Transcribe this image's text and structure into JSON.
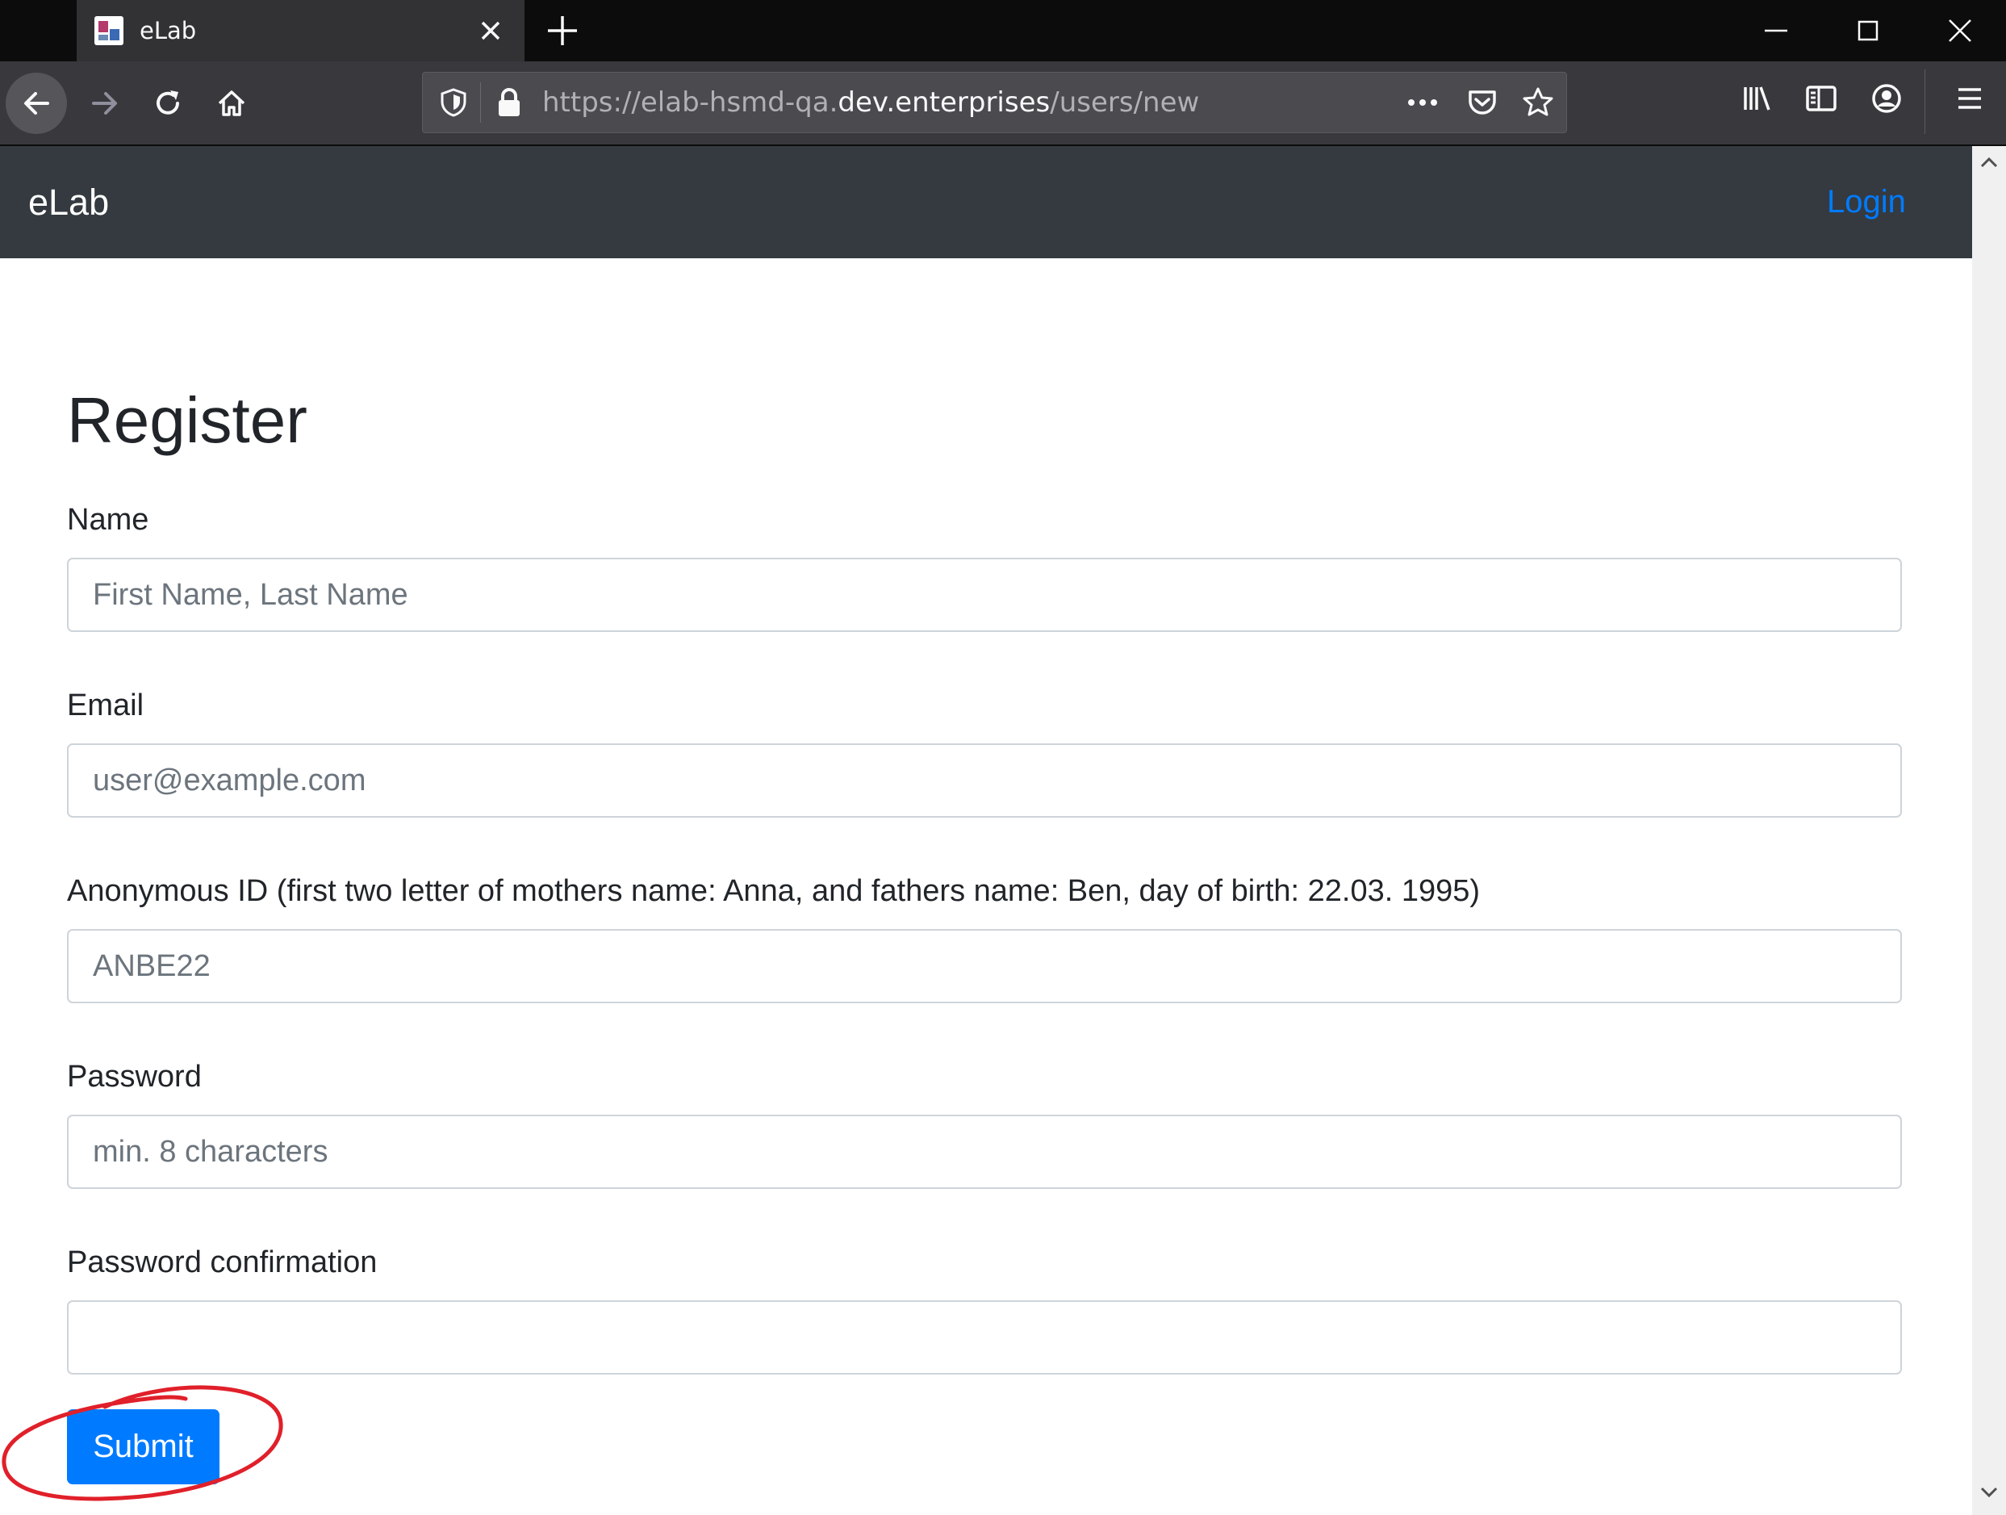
{
  "browser": {
    "tab_title": "eLab",
    "url_prefix": "https://elab-hsmd-qa.",
    "url_domain": "dev.enterprises",
    "url_path": "/users/new"
  },
  "app": {
    "brand": "eLab",
    "login_label": "Login"
  },
  "form": {
    "title": "Register",
    "name_label": "Name",
    "name_placeholder": "First Name, Last Name",
    "email_label": "Email",
    "email_placeholder": "user@example.com",
    "anon_label": "Anonymous ID (first two letter of mothers name: Anna, and fathers name: Ben, day of birth: 22.03. 1995)",
    "anon_placeholder": "ANBE22",
    "password_label": "Password",
    "password_placeholder": "min. 8 characters",
    "password_confirmation_label": "Password confirmation",
    "password_confirmation_placeholder": "",
    "submit_label": "Submit"
  },
  "colors": {
    "navbar": "#343a40",
    "primary": "#007bff",
    "annotation": "#e0202a"
  }
}
